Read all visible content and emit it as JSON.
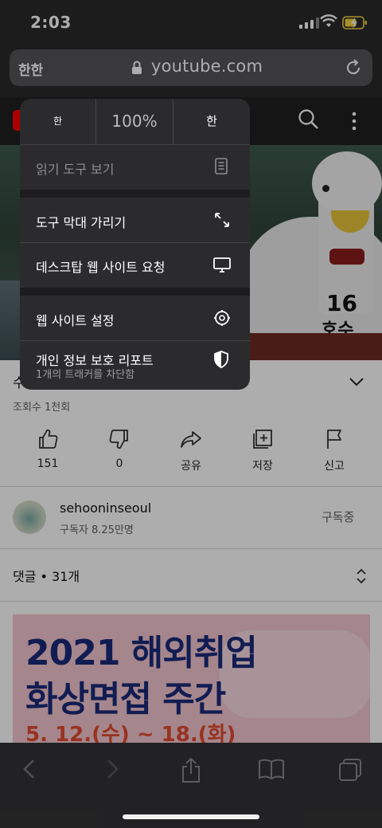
{
  "status": {
    "time": "2:03"
  },
  "browser": {
    "text_size_label": "한한",
    "url": "youtube.com"
  },
  "video": {
    "title_visible": "수",
    "views": "조회수 1천회",
    "overlay_number": "16",
    "overlay_text": "호수"
  },
  "actions": [
    {
      "label": "151",
      "icon": "thumbs-up-icon"
    },
    {
      "label": "0",
      "icon": "thumbs-down-icon"
    },
    {
      "label": "공유",
      "icon": "share-icon"
    },
    {
      "label": "저장",
      "icon": "save-icon"
    },
    {
      "label": "신고",
      "icon": "flag-icon"
    }
  ],
  "channel": {
    "name": "sehooninseoul",
    "subscribers": "구독자 8.25만명",
    "subscribe_label": "구독중"
  },
  "comments": {
    "label": "댓글 • 31개"
  },
  "ad": {
    "line1": "2021 해외취업",
    "line2": "화상면접 주간",
    "line3": "5. 12.(수) ~ 18.(화)"
  },
  "menu": {
    "zoom": {
      "smaller": "한",
      "value": "100%",
      "larger": "한"
    },
    "items": [
      {
        "label": "읽기 도구 보기",
        "icon": "reader-icon"
      },
      {
        "label": "도구 막대 가리기",
        "icon": "resize-icon"
      },
      {
        "label": "데스크탑 웹 사이트 요청",
        "icon": "desktop-icon"
      },
      {
        "label": "웹 사이트 설정",
        "icon": "gear-icon"
      },
      {
        "label": "개인 정보 보호 리포트",
        "sublabel": "1개의 트래커를 차단함",
        "icon": "shield-icon"
      }
    ]
  },
  "colors": {
    "menu_bg": "#2b2b2d",
    "youtube_red": "#ff0000",
    "battery": "#f4d33b"
  }
}
